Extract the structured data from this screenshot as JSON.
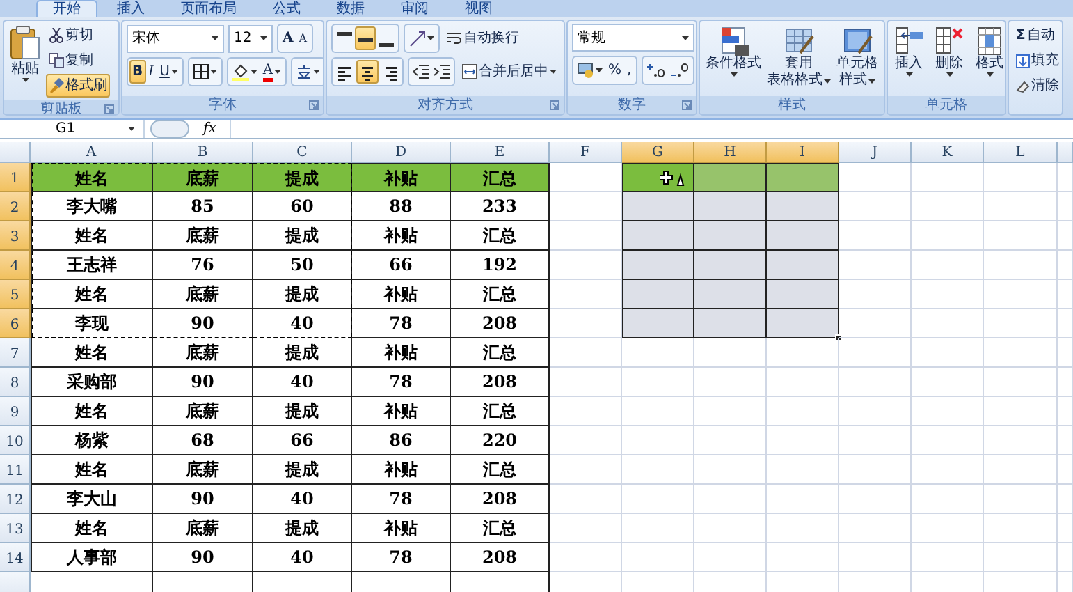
{
  "ribbon": {
    "tabs": [
      {
        "label": "开始",
        "selected": true
      },
      {
        "label": "插入",
        "selected": false
      },
      {
        "label": "页面布局",
        "selected": false
      },
      {
        "label": "公式",
        "selected": false
      },
      {
        "label": "数据",
        "selected": false
      },
      {
        "label": "审阅",
        "selected": false
      },
      {
        "label": "视图",
        "selected": false
      }
    ],
    "groups": [
      {
        "kind": "clipboard",
        "label": "剪贴板",
        "paste": "粘贴",
        "cut": "剪切",
        "copy": "复制",
        "format_painter": {
          "label": "格式刷",
          "on": true
        }
      },
      {
        "kind": "font",
        "label": "字体",
        "font_name": "宋体",
        "font_size": "12",
        "grow": "A",
        "shrink": "A",
        "bold": {
          "label": "B",
          "on": true
        },
        "italic": {
          "label": "I",
          "on": false
        },
        "underline": {
          "label": "U",
          "on": false
        },
        "font_color": "A"
      },
      {
        "kind": "alignment",
        "label": "对齐方式",
        "vertical_buttons": [
          {
            "selected": false
          },
          {
            "selected": true
          },
          {
            "selected": false
          }
        ],
        "horizontal_buttons": [
          {
            "selected": false
          },
          {
            "selected": true
          },
          {
            "selected": false
          }
        ],
        "wrap": "自动换行",
        "merge": "合并后居中"
      },
      {
        "kind": "number",
        "label": "数字",
        "format": "常规",
        "percent": "%",
        "comma": ","
      },
      {
        "kind": "styles",
        "label": "样式",
        "buttons": [
          {
            "lines": [
              "条件格式"
            ]
          },
          {
            "lines": [
              "套用",
              "表格格式"
            ]
          },
          {
            "lines": [
              "单元格",
              "样式"
            ]
          }
        ]
      },
      {
        "kind": "cells",
        "label": "单元格",
        "buttons": [
          {
            "lines": [
              "插入"
            ]
          },
          {
            "lines": [
              "删除"
            ]
          },
          {
            "lines": [
              "格式"
            ]
          }
        ]
      },
      {
        "kind": "editing",
        "items": [
          {
            "kind": "autosum",
            "symbol": "Σ",
            "label": "自动"
          },
          {
            "kind": "fill",
            "label": "填充"
          },
          {
            "kind": "clear",
            "label": "清除"
          }
        ]
      }
    ]
  },
  "formula_bar": {
    "name_box": "G1",
    "function_label": "fx"
  },
  "sheet": {
    "columns": [
      {
        "label": "A",
        "selected": false,
        "bordered": true,
        "copied": true
      },
      {
        "label": "B",
        "selected": false,
        "bordered": true,
        "copied": true
      },
      {
        "label": "C",
        "selected": false,
        "bordered": true,
        "copied": true
      },
      {
        "label": "D",
        "selected": false,
        "bordered": true,
        "copied": false
      },
      {
        "label": "E",
        "selected": false,
        "bordered": true,
        "copied": false
      },
      {
        "label": "F",
        "selected": false,
        "bordered": false,
        "copied": false
      },
      {
        "label": "G",
        "selected": true,
        "bordered": false,
        "copied": false
      },
      {
        "label": "H",
        "selected": true,
        "bordered": false,
        "copied": false
      },
      {
        "label": "I",
        "selected": true,
        "bordered": false,
        "copied": false
      },
      {
        "label": "J",
        "selected": false,
        "bordered": false,
        "copied": false
      },
      {
        "label": "K",
        "selected": false,
        "bordered": false,
        "copied": false
      },
      {
        "label": "L",
        "selected": false,
        "bordered": false,
        "copied": false
      }
    ],
    "rows": [
      {
        "number": "1",
        "selected": true,
        "copied": true,
        "header": true,
        "cells": [
          "姓名",
          "底薪",
          "提成",
          "补贴",
          "汇总"
        ]
      },
      {
        "number": "2",
        "selected": true,
        "copied": true,
        "header": false,
        "cells": [
          "李大嘴",
          "85",
          "60",
          "88",
          "233"
        ]
      },
      {
        "number": "3",
        "selected": true,
        "copied": true,
        "header": false,
        "cells": [
          "姓名",
          "底薪",
          "提成",
          "补贴",
          "汇总"
        ]
      },
      {
        "number": "4",
        "selected": true,
        "copied": true,
        "header": false,
        "cells": [
          "王志祥",
          "76",
          "50",
          "66",
          "192"
        ]
      },
      {
        "number": "5",
        "selected": true,
        "copied": true,
        "header": false,
        "cells": [
          "姓名",
          "底薪",
          "提成",
          "补贴",
          "汇总"
        ]
      },
      {
        "number": "6",
        "selected": true,
        "copied": true,
        "header": false,
        "cells": [
          "李现",
          "90",
          "40",
          "78",
          "208"
        ]
      },
      {
        "number": "7",
        "selected": false,
        "copied": false,
        "header": false,
        "cells": [
          "姓名",
          "底薪",
          "提成",
          "补贴",
          "汇总"
        ]
      },
      {
        "number": "8",
        "selected": false,
        "copied": false,
        "header": false,
        "cells": [
          "采购部",
          "90",
          "40",
          "78",
          "208"
        ]
      },
      {
        "number": "9",
        "selected": false,
        "copied": false,
        "header": false,
        "cells": [
          "姓名",
          "底薪",
          "提成",
          "补贴",
          "汇总"
        ]
      },
      {
        "number": "10",
        "selected": false,
        "copied": false,
        "header": false,
        "cells": [
          "杨紫",
          "68",
          "66",
          "86",
          "220"
        ]
      },
      {
        "number": "11",
        "selected": false,
        "copied": false,
        "header": false,
        "cells": [
          "姓名",
          "底薪",
          "提成",
          "补贴",
          "汇总"
        ]
      },
      {
        "number": "12",
        "selected": false,
        "copied": false,
        "header": false,
        "cells": [
          "李大山",
          "90",
          "40",
          "78",
          "208"
        ]
      },
      {
        "number": "13",
        "selected": false,
        "copied": false,
        "header": false,
        "cells": [
          "姓名",
          "底薪",
          "提成",
          "补贴",
          "汇总"
        ]
      },
      {
        "number": "14",
        "selected": false,
        "copied": false,
        "header": false,
        "cells": [
          "人事部",
          "90",
          "40",
          "78",
          "208"
        ]
      }
    ]
  }
}
